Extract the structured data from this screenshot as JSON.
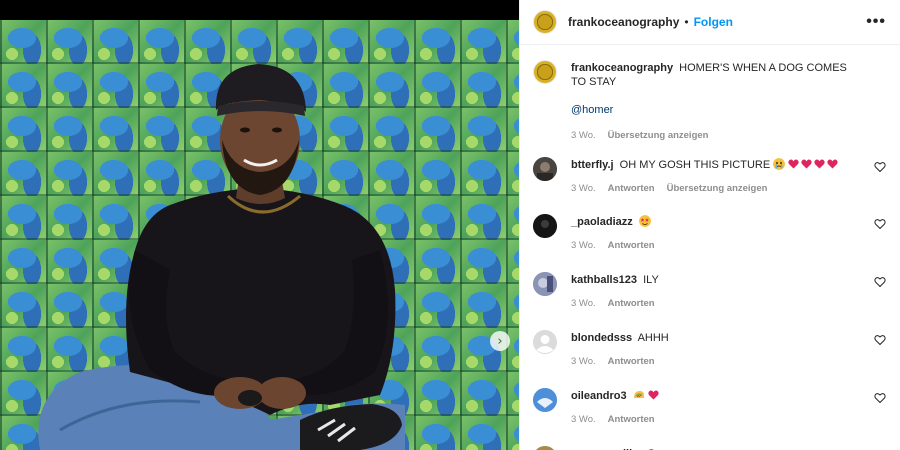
{
  "post": {
    "username": "frankoceanography",
    "follow_label": "Folgen",
    "separator": "•",
    "more_icon": "•••"
  },
  "caption": {
    "username": "frankoceanography",
    "text": "HOMER'S WHEN A DOG COMES TO STAY",
    "mention": "@homer",
    "time": "3 Wo.",
    "translate": "Übersetzung anzeigen"
  },
  "comments": [
    {
      "username": "btterfly.j",
      "text": "OH MY GOSH THIS PICTURE",
      "emoji": "crying-face + 4 red hearts",
      "time": "3 Wo.",
      "reply": "Antworten",
      "translate": "Übersetzung anzeigen"
    },
    {
      "username": "_paoladiazz",
      "text": "",
      "emoji": "star-struck face",
      "time": "3 Wo.",
      "reply": "Antworten"
    },
    {
      "username": "kathballs123",
      "text": "ILY",
      "time": "3 Wo.",
      "reply": "Antworten"
    },
    {
      "username": "blondedsss",
      "text": "AHHH",
      "time": "3 Wo.",
      "reply": "Antworten"
    },
    {
      "username": "oileandro3",
      "text": "",
      "emoji": "taco + red heart",
      "time": "3 Wo.",
      "reply": "Antworten"
    },
    {
      "username": "quemarcellis",
      "text": "",
      "emoji": "wave"
    }
  ],
  "colors": {
    "link_blue": "#0095f6",
    "mention_blue": "#00376b",
    "text": "#262626",
    "muted": "#8e8e8e",
    "heart_red": "#ed4956"
  },
  "icons": {
    "next": "chevron-right-icon",
    "like": "heart-outline-icon",
    "more": "ellipsis-icon"
  }
}
